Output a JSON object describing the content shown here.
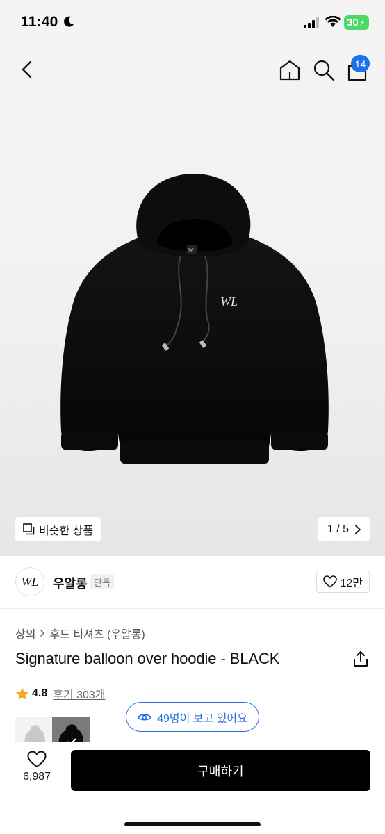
{
  "status_bar": {
    "time": "11:40",
    "battery": "30"
  },
  "header": {
    "cart_count": "14"
  },
  "gallery": {
    "similar_label": "비슷한 상품",
    "page_indicator": "1 / 5"
  },
  "brand": {
    "logo_text": "WL",
    "name": "우알롱",
    "tag": "단독",
    "like_count": "12만"
  },
  "product": {
    "breadcrumb": [
      "상의",
      "후드 티셔츠 (우알롱)"
    ],
    "title": "Signature balloon over hoodie - BLACK",
    "rating": "4.8",
    "reviews": "후기 303개",
    "viewers": "49명이 보고 있어요"
  },
  "bottom_bar": {
    "wish_count": "6,987",
    "buy_label": "구매하기"
  },
  "colors": {
    "accent": "#2b6fe0",
    "badge": "#1a73e8",
    "buy": "#000000",
    "star": "#f5a623",
    "battery": "#4cd964"
  },
  "icons": [
    "back-icon",
    "home-icon",
    "search-icon",
    "shopping-bag-icon",
    "similar-icon",
    "chevron-right-icon",
    "heart-icon",
    "share-icon",
    "star-icon",
    "eye-icon"
  ]
}
